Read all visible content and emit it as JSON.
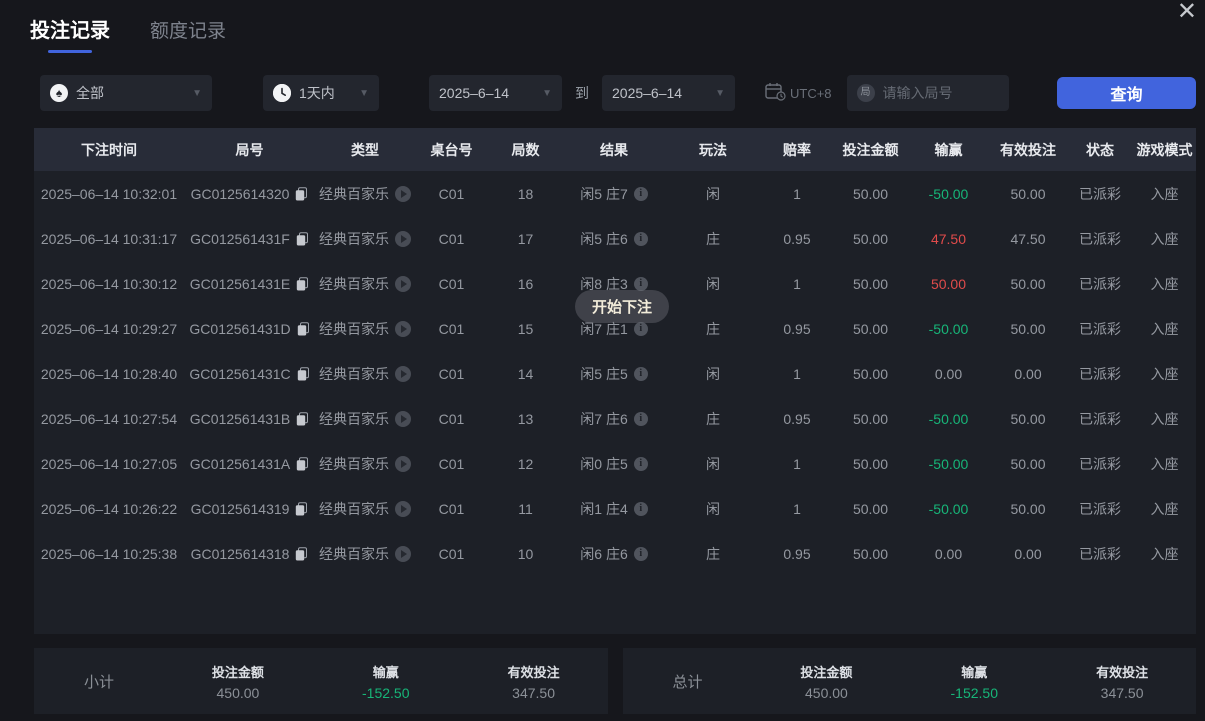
{
  "window": {
    "close_icon": "✕"
  },
  "tabs": [
    {
      "label": "投注记录",
      "active": true
    },
    {
      "label": "额度记录",
      "active": false
    }
  ],
  "icons": {
    "spade": "♠",
    "chevron_down": "▼",
    "info": "i",
    "round_input": "局"
  },
  "filters": {
    "game_type": {
      "value": "全部"
    },
    "time_range": {
      "value": "1天内"
    },
    "date_from": "2025–6–14",
    "to_label": "到",
    "date_to": "2025–6–14",
    "timezone": "UTC+8",
    "round_input": {
      "placeholder": "请输入局号",
      "value": ""
    },
    "search_button": "查询"
  },
  "table": {
    "headers": [
      "下注时间",
      "局号",
      "类型",
      "桌台号",
      "局数",
      "结果",
      "玩法",
      "赔率",
      "投注金额",
      "输赢",
      "有效投注",
      "状态",
      "游戏模式"
    ],
    "rows": [
      {
        "time": "2025–06–14 10:32:01",
        "round_id": "GC0125614320",
        "type": "经典百家乐",
        "table_no": "C01",
        "round_count": "18",
        "result": "闲5 庄7",
        "play": "闲",
        "odds": "1",
        "bet": "50.00",
        "win": "-50.00",
        "valid": "50.00",
        "status": "已派彩",
        "mode": "入座"
      },
      {
        "time": "2025–06–14 10:31:17",
        "round_id": "GC012561431F",
        "type": "经典百家乐",
        "table_no": "C01",
        "round_count": "17",
        "result": "闲5 庄6",
        "play": "庄",
        "odds": "0.95",
        "bet": "50.00",
        "win": "47.50",
        "valid": "47.50",
        "status": "已派彩",
        "mode": "入座"
      },
      {
        "time": "2025–06–14 10:30:12",
        "round_id": "GC012561431E",
        "type": "经典百家乐",
        "table_no": "C01",
        "round_count": "16",
        "result": "闲8 庄3",
        "play": "闲",
        "odds": "1",
        "bet": "50.00",
        "win": "50.00",
        "valid": "50.00",
        "status": "已派彩",
        "mode": "入座"
      },
      {
        "time": "2025–06–14 10:29:27",
        "round_id": "GC012561431D",
        "type": "经典百家乐",
        "table_no": "C01",
        "round_count": "15",
        "result": "闲7 庄1",
        "play": "庄",
        "odds": "0.95",
        "bet": "50.00",
        "win": "-50.00",
        "valid": "50.00",
        "status": "已派彩",
        "mode": "入座"
      },
      {
        "time": "2025–06–14 10:28:40",
        "round_id": "GC012561431C",
        "type": "经典百家乐",
        "table_no": "C01",
        "round_count": "14",
        "result": "闲5 庄5",
        "play": "闲",
        "odds": "1",
        "bet": "50.00",
        "win": "0.00",
        "valid": "0.00",
        "status": "已派彩",
        "mode": "入座"
      },
      {
        "time": "2025–06–14 10:27:54",
        "round_id": "GC012561431B",
        "type": "经典百家乐",
        "table_no": "C01",
        "round_count": "13",
        "result": "闲7 庄6",
        "play": "庄",
        "odds": "0.95",
        "bet": "50.00",
        "win": "-50.00",
        "valid": "50.00",
        "status": "已派彩",
        "mode": "入座"
      },
      {
        "time": "2025–06–14 10:27:05",
        "round_id": "GC012561431A",
        "type": "经典百家乐",
        "table_no": "C01",
        "round_count": "12",
        "result": "闲0 庄5",
        "play": "闲",
        "odds": "1",
        "bet": "50.00",
        "win": "-50.00",
        "valid": "50.00",
        "status": "已派彩",
        "mode": "入座"
      },
      {
        "time": "2025–06–14 10:26:22",
        "round_id": "GC0125614319",
        "type": "经典百家乐",
        "table_no": "C01",
        "round_count": "11",
        "result": "闲1 庄4",
        "play": "闲",
        "odds": "1",
        "bet": "50.00",
        "win": "-50.00",
        "valid": "50.00",
        "status": "已派彩",
        "mode": "入座"
      },
      {
        "time": "2025–06–14 10:25:38",
        "round_id": "GC0125614318",
        "type": "经典百家乐",
        "table_no": "C01",
        "round_count": "10",
        "result": "闲6 庄6",
        "play": "庄",
        "odds": "0.95",
        "bet": "50.00",
        "win": "0.00",
        "valid": "0.00",
        "status": "已派彩",
        "mode": "入座"
      }
    ]
  },
  "toast": {
    "label": "开始下注"
  },
  "summary": {
    "subtotal": {
      "label": "小计",
      "bet_label": "投注金额",
      "bet": "450.00",
      "win_label": "输赢",
      "win": "-152.50",
      "valid_label": "有效投注",
      "valid": "347.50"
    },
    "total": {
      "label": "总计",
      "bet_label": "投注金额",
      "bet": "450.00",
      "win_label": "输赢",
      "win": "-152.50",
      "valid_label": "有效投注",
      "valid": "347.50"
    }
  },
  "colors": {
    "accent": "#4164dd",
    "win_positive": "#e04b4b",
    "win_negative": "#17b578",
    "panel_bg": "#1d2027",
    "header_bg": "#282c38",
    "page_bg": "#16171c"
  }
}
